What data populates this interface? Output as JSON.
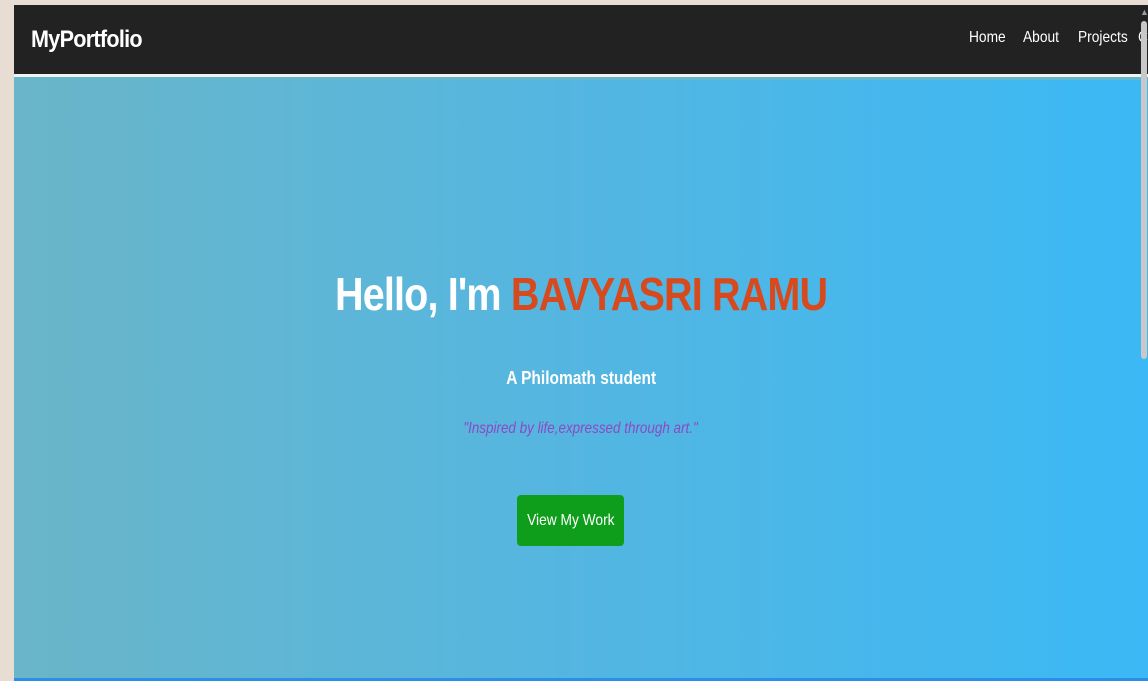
{
  "navbar": {
    "brand": "MyPortfolio",
    "links": [
      {
        "label": "Home"
      },
      {
        "label": "About"
      },
      {
        "label": "Projects"
      },
      {
        "label": "Co"
      }
    ]
  },
  "hero": {
    "greeting": "Hello, I'm ",
    "name": "BAVYASRI RAMU",
    "subtitle": "A Philomath student",
    "quote": "\"Inspired by life,expressed through art.\"",
    "cta_label": "View My Work"
  },
  "colors": {
    "navbar_bg": "#222222",
    "hero_gradient_start": "#6ab5c8",
    "hero_gradient_end": "#3bb8f5",
    "name_accent": "#d64a1e",
    "quote_color": "#8e48c4",
    "cta_bg": "#0f9e1b"
  },
  "icons": {
    "scroll_up": "▲"
  }
}
